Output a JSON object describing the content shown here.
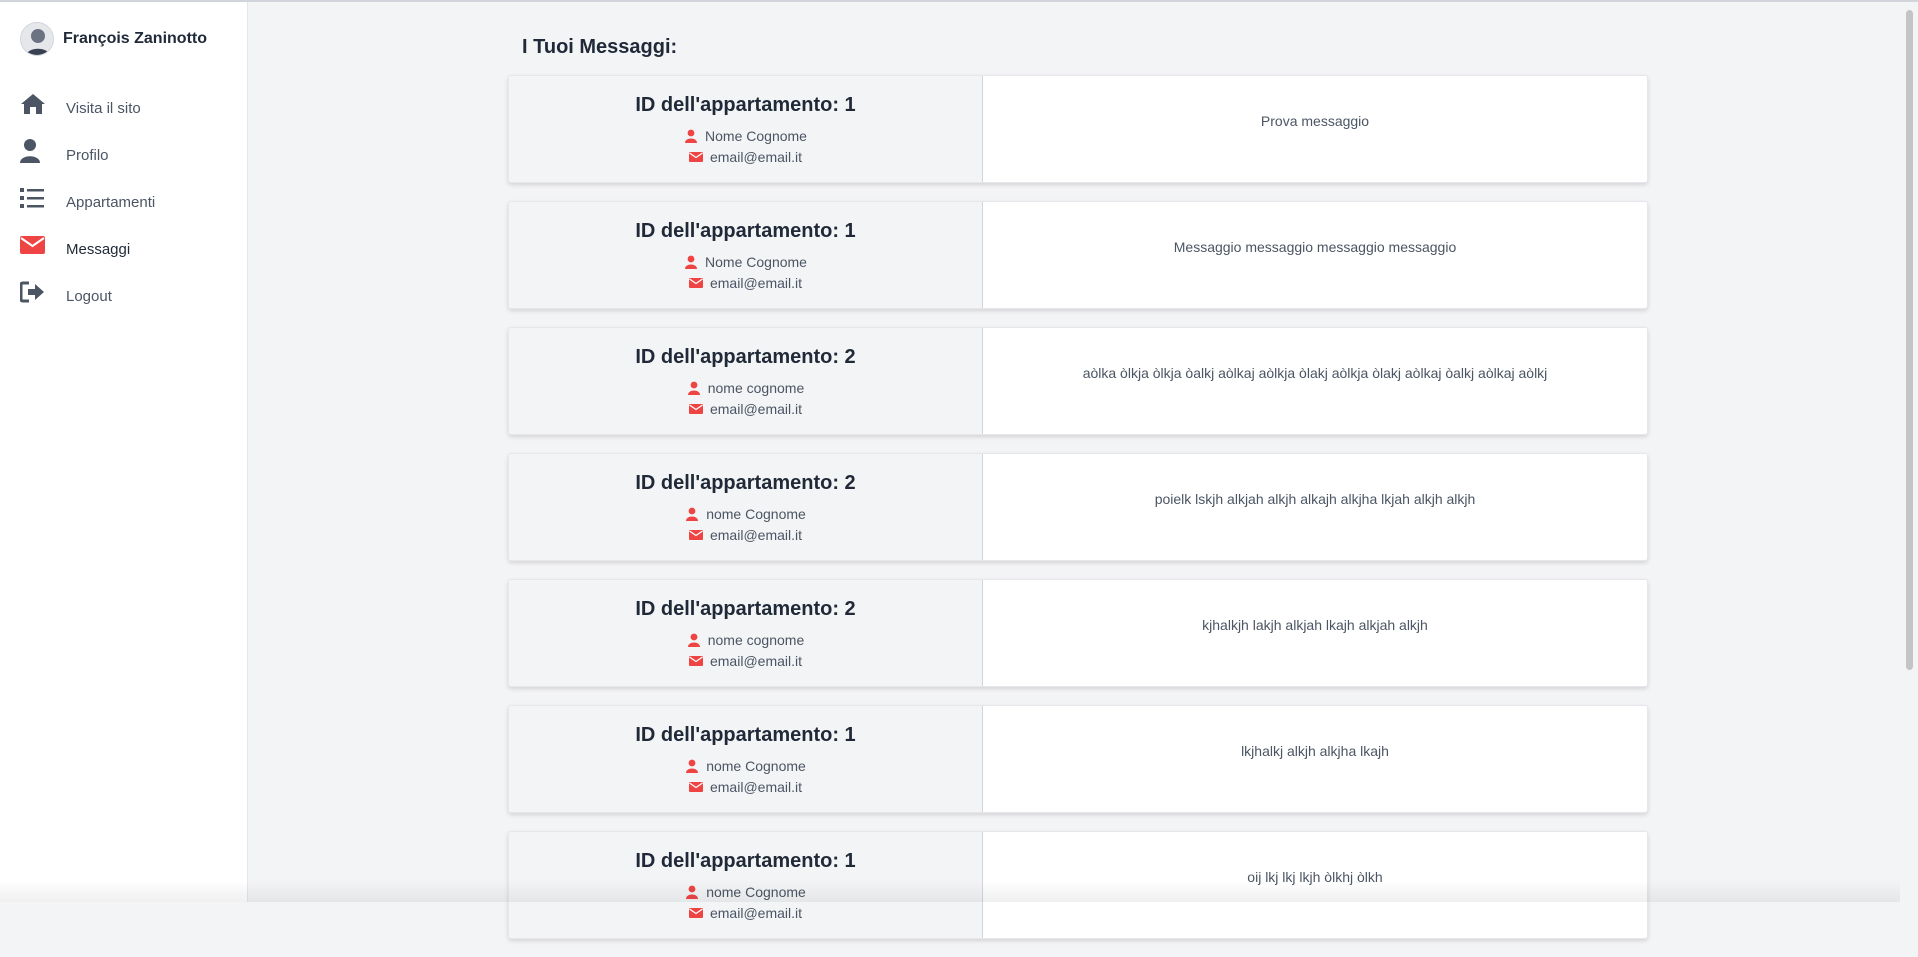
{
  "colors": {
    "accent": "#ef4444",
    "nav_icon": "#4b5563",
    "panel_left": "#f3f4f6",
    "background": "#f3f4f6"
  },
  "user": {
    "name": "François Zaninotto",
    "avatar_icon": "user-photo"
  },
  "sidebar": {
    "items": [
      {
        "label": "Visita il sito",
        "icon": "home-icon",
        "active": false
      },
      {
        "label": "Profilo",
        "icon": "user-icon",
        "active": false
      },
      {
        "label": "Appartamenti",
        "icon": "list-icon",
        "active": false
      },
      {
        "label": "Messaggi",
        "icon": "envelope-icon",
        "active": true
      },
      {
        "label": "Logout",
        "icon": "sign-out-icon",
        "active": false
      }
    ]
  },
  "main": {
    "title": "I Tuoi Messaggi:",
    "messages": [
      {
        "apartment": "ID dell'appartamento: 1",
        "name": "Nome Cognome",
        "email": "email@email.it",
        "text": "Prova messaggio"
      },
      {
        "apartment": "ID dell'appartamento: 1",
        "name": "Nome Cognome",
        "email": "email@email.it",
        "text": "Messaggio messaggio messaggio messaggio"
      },
      {
        "apartment": "ID dell'appartamento: 2",
        "name": "nome cognome",
        "email": "email@email.it",
        "text": "aòlka òlkja òlkja òalkj aòlkaj aòlkja òlakj aòlkja òlakj aòlkaj òalkj aòlkaj aòlkj"
      },
      {
        "apartment": "ID dell'appartamento: 2",
        "name": "nome Cognome",
        "email": "email@email.it",
        "text": "poielk lskjh alkjah alkjh alkajh alkjha lkjah alkjh alkjh"
      },
      {
        "apartment": "ID dell'appartamento: 2",
        "name": "nome cognome",
        "email": "email@email.it",
        "text": "kjhalkjh lakjh alkjah lkajh alkjah alkjh"
      },
      {
        "apartment": "ID dell'appartamento: 1",
        "name": "nome Cognome",
        "email": "email@email.it",
        "text": "lkjhalkj alkjh alkjha lkajh"
      },
      {
        "apartment": "ID dell'appartamento: 1",
        "name": "nome Cognome",
        "email": "email@email.it",
        "text": "oij lkj lkj lkjh òlkhj òlkh"
      }
    ]
  }
}
